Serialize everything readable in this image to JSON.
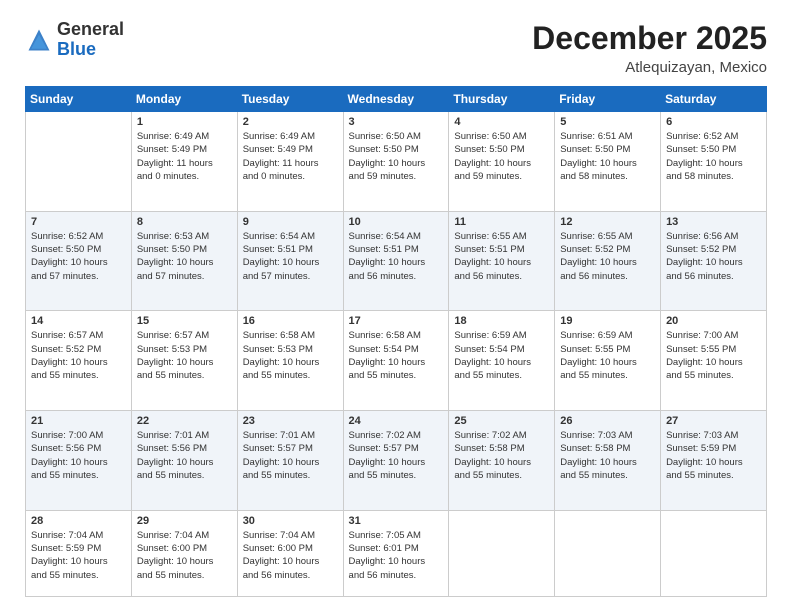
{
  "header": {
    "logo_line1": "General",
    "logo_line2": "Blue",
    "month": "December 2025",
    "location": "Atlequizayan, Mexico"
  },
  "weekdays": [
    "Sunday",
    "Monday",
    "Tuesday",
    "Wednesday",
    "Thursday",
    "Friday",
    "Saturday"
  ],
  "weeks": [
    [
      {
        "day": "",
        "info": ""
      },
      {
        "day": "1",
        "info": "Sunrise: 6:49 AM\nSunset: 5:49 PM\nDaylight: 11 hours\nand 0 minutes."
      },
      {
        "day": "2",
        "info": "Sunrise: 6:49 AM\nSunset: 5:49 PM\nDaylight: 11 hours\nand 0 minutes."
      },
      {
        "day": "3",
        "info": "Sunrise: 6:50 AM\nSunset: 5:50 PM\nDaylight: 10 hours\nand 59 minutes."
      },
      {
        "day": "4",
        "info": "Sunrise: 6:50 AM\nSunset: 5:50 PM\nDaylight: 10 hours\nand 59 minutes."
      },
      {
        "day": "5",
        "info": "Sunrise: 6:51 AM\nSunset: 5:50 PM\nDaylight: 10 hours\nand 58 minutes."
      },
      {
        "day": "6",
        "info": "Sunrise: 6:52 AM\nSunset: 5:50 PM\nDaylight: 10 hours\nand 58 minutes."
      }
    ],
    [
      {
        "day": "7",
        "info": "Sunrise: 6:52 AM\nSunset: 5:50 PM\nDaylight: 10 hours\nand 57 minutes."
      },
      {
        "day": "8",
        "info": "Sunrise: 6:53 AM\nSunset: 5:50 PM\nDaylight: 10 hours\nand 57 minutes."
      },
      {
        "day": "9",
        "info": "Sunrise: 6:54 AM\nSunset: 5:51 PM\nDaylight: 10 hours\nand 57 minutes."
      },
      {
        "day": "10",
        "info": "Sunrise: 6:54 AM\nSunset: 5:51 PM\nDaylight: 10 hours\nand 56 minutes."
      },
      {
        "day": "11",
        "info": "Sunrise: 6:55 AM\nSunset: 5:51 PM\nDaylight: 10 hours\nand 56 minutes."
      },
      {
        "day": "12",
        "info": "Sunrise: 6:55 AM\nSunset: 5:52 PM\nDaylight: 10 hours\nand 56 minutes."
      },
      {
        "day": "13",
        "info": "Sunrise: 6:56 AM\nSunset: 5:52 PM\nDaylight: 10 hours\nand 56 minutes."
      }
    ],
    [
      {
        "day": "14",
        "info": "Sunrise: 6:57 AM\nSunset: 5:52 PM\nDaylight: 10 hours\nand 55 minutes."
      },
      {
        "day": "15",
        "info": "Sunrise: 6:57 AM\nSunset: 5:53 PM\nDaylight: 10 hours\nand 55 minutes."
      },
      {
        "day": "16",
        "info": "Sunrise: 6:58 AM\nSunset: 5:53 PM\nDaylight: 10 hours\nand 55 minutes."
      },
      {
        "day": "17",
        "info": "Sunrise: 6:58 AM\nSunset: 5:54 PM\nDaylight: 10 hours\nand 55 minutes."
      },
      {
        "day": "18",
        "info": "Sunrise: 6:59 AM\nSunset: 5:54 PM\nDaylight: 10 hours\nand 55 minutes."
      },
      {
        "day": "19",
        "info": "Sunrise: 6:59 AM\nSunset: 5:55 PM\nDaylight: 10 hours\nand 55 minutes."
      },
      {
        "day": "20",
        "info": "Sunrise: 7:00 AM\nSunset: 5:55 PM\nDaylight: 10 hours\nand 55 minutes."
      }
    ],
    [
      {
        "day": "21",
        "info": "Sunrise: 7:00 AM\nSunset: 5:56 PM\nDaylight: 10 hours\nand 55 minutes."
      },
      {
        "day": "22",
        "info": "Sunrise: 7:01 AM\nSunset: 5:56 PM\nDaylight: 10 hours\nand 55 minutes."
      },
      {
        "day": "23",
        "info": "Sunrise: 7:01 AM\nSunset: 5:57 PM\nDaylight: 10 hours\nand 55 minutes."
      },
      {
        "day": "24",
        "info": "Sunrise: 7:02 AM\nSunset: 5:57 PM\nDaylight: 10 hours\nand 55 minutes."
      },
      {
        "day": "25",
        "info": "Sunrise: 7:02 AM\nSunset: 5:58 PM\nDaylight: 10 hours\nand 55 minutes."
      },
      {
        "day": "26",
        "info": "Sunrise: 7:03 AM\nSunset: 5:58 PM\nDaylight: 10 hours\nand 55 minutes."
      },
      {
        "day": "27",
        "info": "Sunrise: 7:03 AM\nSunset: 5:59 PM\nDaylight: 10 hours\nand 55 minutes."
      }
    ],
    [
      {
        "day": "28",
        "info": "Sunrise: 7:04 AM\nSunset: 5:59 PM\nDaylight: 10 hours\nand 55 minutes."
      },
      {
        "day": "29",
        "info": "Sunrise: 7:04 AM\nSunset: 6:00 PM\nDaylight: 10 hours\nand 55 minutes."
      },
      {
        "day": "30",
        "info": "Sunrise: 7:04 AM\nSunset: 6:00 PM\nDaylight: 10 hours\nand 56 minutes."
      },
      {
        "day": "31",
        "info": "Sunrise: 7:05 AM\nSunset: 6:01 PM\nDaylight: 10 hours\nand 56 minutes."
      },
      {
        "day": "",
        "info": ""
      },
      {
        "day": "",
        "info": ""
      },
      {
        "day": "",
        "info": ""
      }
    ]
  ]
}
